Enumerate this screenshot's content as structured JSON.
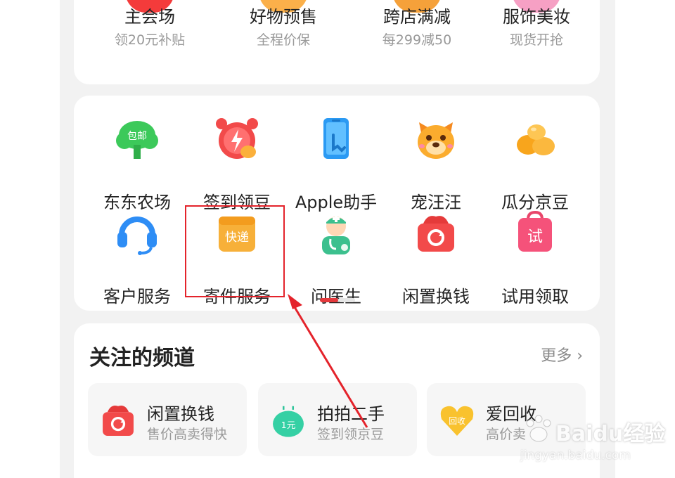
{
  "top_row": [
    {
      "title": "主会场",
      "subtitle": "领20元补贴",
      "icon": "red-cloud-icon",
      "color": "#f43b3b"
    },
    {
      "title": "好物预售",
      "subtitle": "全程价保",
      "icon": "orange-cloud-icon",
      "color": "#fbb04a"
    },
    {
      "title": "跨店满减",
      "subtitle": "每299减50",
      "icon": "orange-basket-icon",
      "color": "#f5a13a"
    },
    {
      "title": "服饰美妆",
      "subtitle": "现货开抢",
      "icon": "pink-cloud-icon",
      "color": "#f6a0c4"
    }
  ],
  "grid": [
    {
      "label": "东东农场",
      "icon": "farm-tree-icon",
      "badge": "包邮"
    },
    {
      "label": "签到领豆",
      "icon": "alarm-clock-icon"
    },
    {
      "label": "Apple助手",
      "icon": "phone-tap-icon"
    },
    {
      "label": "宠汪汪",
      "icon": "dog-face-icon"
    },
    {
      "label": "瓜分京豆",
      "icon": "beans-icon"
    },
    {
      "label": "客户服务",
      "icon": "headset-icon"
    },
    {
      "label": "寄件服务",
      "icon": "express-box-icon",
      "badge": "快递"
    },
    {
      "label": "问医生",
      "icon": "doctor-icon"
    },
    {
      "label": "闲置换钱",
      "icon": "recycle-basket-icon"
    },
    {
      "label": "试用领取",
      "icon": "trial-bag-icon",
      "badge": "试"
    }
  ],
  "channels": {
    "title": "关注的频道",
    "more": "更多",
    "items": [
      {
        "title": "闲置换钱",
        "subtitle": "售价高卖得快",
        "icon": "recycle-basket-icon"
      },
      {
        "title": "拍拍二手",
        "subtitle": "签到领京豆",
        "icon": "paipai-icon",
        "badge": "1元"
      },
      {
        "title": "爱回收",
        "subtitle": "高价卖",
        "icon": "heart-recycle-icon",
        "badge": "回收"
      }
    ]
  },
  "watermark": {
    "brand": "Baidu经验",
    "url": "jingyan.baidu.com"
  },
  "accent": "#e4393c"
}
